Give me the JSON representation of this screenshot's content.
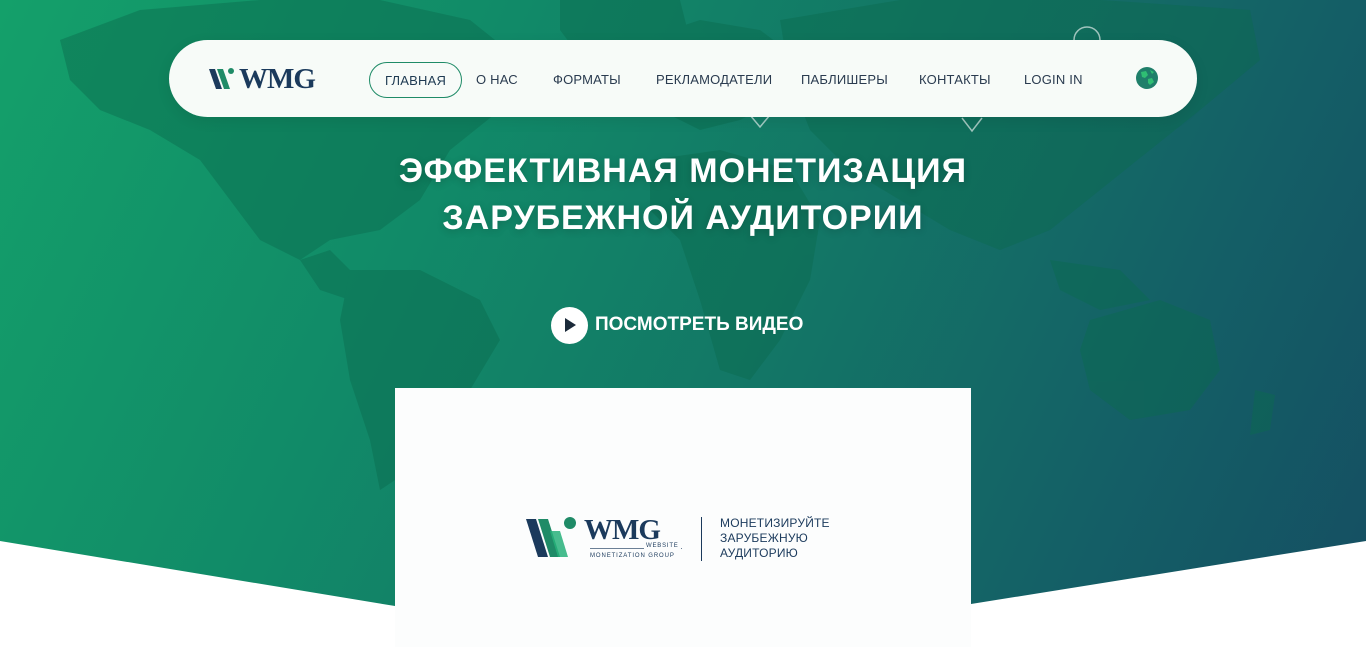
{
  "header": {
    "logo_text": "WMG",
    "nav": [
      {
        "label": "ГЛАВНАЯ",
        "active": true
      },
      {
        "label": "О НАС"
      },
      {
        "label": "ФОРМАТЫ"
      },
      {
        "label": "РЕКЛАМОДАТЕЛИ"
      },
      {
        "label": "ПАБЛИШЕРЫ"
      },
      {
        "label": "КОНТАКТЫ"
      },
      {
        "label": "LOGIN IN"
      }
    ],
    "language_icon": "globe-icon"
  },
  "hero": {
    "title_line1": "ЭФФЕКТИВНАЯ МОНЕТИЗАЦИЯ",
    "title_line2": "ЗАРУБЕЖНОЙ АУДИТОРИИ",
    "video_button_label": "ПОСМОТРЕТЬ ВИДЕО",
    "video_icon": "play-icon"
  },
  "video_card": {
    "brand": "WMG",
    "brand_sub1": "WEBSITE",
    "brand_sub2": "MONETIZATION GROUP",
    "tagline_line1": "МОНЕТИЗИРУЙТЕ",
    "tagline_line2": "ЗАРУБЕЖНУЮ",
    "tagline_line3": "АУДИТОРИЮ"
  },
  "colors": {
    "brand_navy": "#1b3a5c",
    "brand_green": "#1f8b67",
    "hero_gradient_start": "#14a06a",
    "hero_gradient_end": "#154e62"
  }
}
